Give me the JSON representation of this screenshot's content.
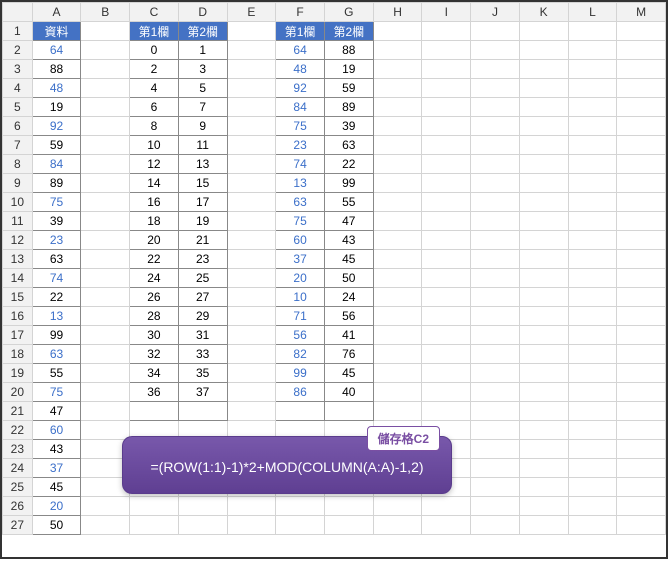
{
  "columns": [
    "A",
    "B",
    "C",
    "D",
    "E",
    "F",
    "G",
    "H",
    "I",
    "J",
    "K",
    "L",
    "M"
  ],
  "rows": [
    1,
    2,
    3,
    4,
    5,
    6,
    7,
    8,
    9,
    10,
    11,
    12,
    13,
    14,
    15,
    16,
    17,
    18,
    19,
    20,
    21,
    22,
    23,
    24,
    25,
    26,
    27
  ],
  "headers": {
    "A1": "資料",
    "C1": "第1欄",
    "D1": "第2欄",
    "F1": "第1欄",
    "G1": "第2欄"
  },
  "colA": [
    {
      "v": "64",
      "blue": true
    },
    {
      "v": "88"
    },
    {
      "v": "48",
      "blue": true
    },
    {
      "v": "19"
    },
    {
      "v": "92",
      "blue": true
    },
    {
      "v": "59"
    },
    {
      "v": "84",
      "blue": true
    },
    {
      "v": "89"
    },
    {
      "v": "75",
      "blue": true
    },
    {
      "v": "39"
    },
    {
      "v": "23",
      "blue": true
    },
    {
      "v": "63"
    },
    {
      "v": "74",
      "blue": true
    },
    {
      "v": "22"
    },
    {
      "v": "13",
      "blue": true
    },
    {
      "v": "99"
    },
    {
      "v": "63",
      "blue": true
    },
    {
      "v": "55"
    },
    {
      "v": "75",
      "blue": true
    },
    {
      "v": "47"
    },
    {
      "v": "60",
      "blue": true
    },
    {
      "v": "43"
    },
    {
      "v": "37",
      "blue": true
    },
    {
      "v": "45"
    },
    {
      "v": "20",
      "blue": true
    },
    {
      "v": "50"
    }
  ],
  "colC": [
    "0",
    "2",
    "4",
    "6",
    "8",
    "10",
    "12",
    "14",
    "16",
    "18",
    "20",
    "22",
    "24",
    "26",
    "28",
    "30",
    "32",
    "34",
    "36"
  ],
  "colD": [
    "1",
    "3",
    "5",
    "7",
    "9",
    "11",
    "13",
    "15",
    "17",
    "19",
    "21",
    "23",
    "25",
    "27",
    "29",
    "31",
    "33",
    "35",
    "37"
  ],
  "colF": [
    "64",
    "48",
    "92",
    "84",
    "75",
    "23",
    "74",
    "13",
    "63",
    "75",
    "60",
    "37",
    "20",
    "10",
    "71",
    "56",
    "82",
    "99",
    "86"
  ],
  "colG": [
    "88",
    "19",
    "59",
    "89",
    "39",
    "63",
    "22",
    "99",
    "55",
    "47",
    "43",
    "45",
    "50",
    "24",
    "56",
    "41",
    "76",
    "45",
    "40"
  ],
  "callout": {
    "label": "儲存格C2",
    "formula": "=(ROW(1:1)-1)*2+MOD(COLUMN(A:A)-1,2)"
  }
}
